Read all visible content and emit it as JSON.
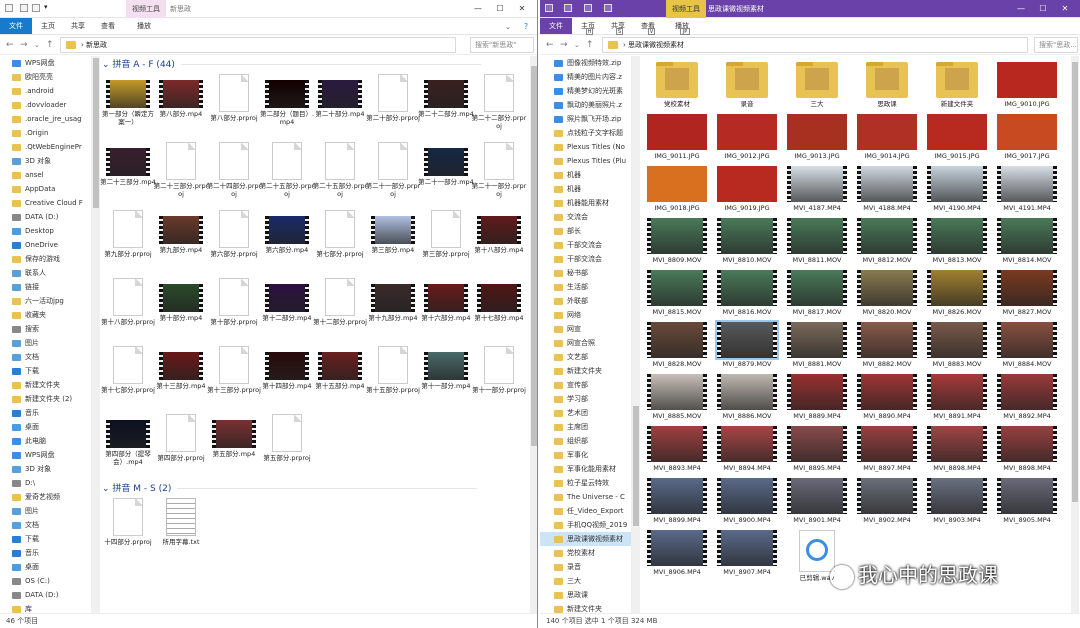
{
  "left": {
    "title": "新思政",
    "context_tab": "视频工具",
    "tabs": [
      "文件",
      "主页",
      "共享",
      "查看",
      "播放"
    ],
    "breadcrumb": "新思政",
    "search": "搜索\"新思政\"",
    "status": "46 个项目",
    "nav": [
      {
        "label": "WPS网盘",
        "icon": "cloud",
        "c": "#3a8ee6"
      },
      {
        "label": "欧阳亮亮",
        "icon": "user",
        "c": "#e8c252"
      },
      {
        "label": ".android",
        "icon": "folder",
        "c": "#e8c252"
      },
      {
        "label": ".dovvloader",
        "icon": "folder",
        "c": "#e8c252"
      },
      {
        "label": ".oracle_jre_usag",
        "icon": "folder",
        "c": "#e8c252"
      },
      {
        "label": ".Origin",
        "icon": "folder",
        "c": "#e8c252"
      },
      {
        "label": ".QtWebEnginePr",
        "icon": "folder",
        "c": "#e8c252"
      },
      {
        "label": "3D 对象",
        "icon": "cube",
        "c": "#5aa0d8"
      },
      {
        "label": "ansel",
        "icon": "folder",
        "c": "#e8c252"
      },
      {
        "label": "AppData",
        "icon": "folder",
        "c": "#e8c252"
      },
      {
        "label": "Creative Cloud F",
        "icon": "folder",
        "c": "#e8c252"
      },
      {
        "label": "DATA (D:)",
        "icon": "drive",
        "c": "#888"
      },
      {
        "label": "Desktop",
        "icon": "folder",
        "c": "#4a9be0"
      },
      {
        "label": "OneDrive",
        "icon": "cloud",
        "c": "#2b7cd3"
      },
      {
        "label": "保存的游戏",
        "icon": "folder",
        "c": "#e8c252"
      },
      {
        "label": "联系人",
        "icon": "folder",
        "c": "#5aa0d8"
      },
      {
        "label": "链接",
        "icon": "link",
        "c": "#5aa0d8"
      },
      {
        "label": "六一活动jpg",
        "icon": "folder",
        "c": "#e8c252"
      },
      {
        "label": "收藏夹",
        "icon": "star",
        "c": "#e8c252"
      },
      {
        "label": "搜索",
        "icon": "search",
        "c": "#888"
      },
      {
        "label": "图片",
        "icon": "folder",
        "c": "#5aa0d8"
      },
      {
        "label": "文档",
        "icon": "folder",
        "c": "#5aa0d8"
      },
      {
        "label": "下载",
        "icon": "down",
        "c": "#2b7cd3"
      },
      {
        "label": "新建文件夹",
        "icon": "folder",
        "c": "#e8c252"
      },
      {
        "label": "新建文件夹 (2)",
        "icon": "folder",
        "c": "#e8c252"
      },
      {
        "label": "音乐",
        "icon": "music",
        "c": "#2b7cd3"
      },
      {
        "label": "桌面",
        "icon": "folder",
        "c": "#4a9be0"
      },
      {
        "label": "此电脑",
        "icon": "pc",
        "c": "#3a8ee6"
      },
      {
        "label": "WPS网盘",
        "icon": "cloud",
        "c": "#3a8ee6"
      },
      {
        "label": "3D 对象",
        "icon": "cube",
        "c": "#5aa0d8"
      },
      {
        "label": "D:\\",
        "icon": "drive",
        "c": "#888"
      },
      {
        "label": "爱奇艺视频",
        "icon": "folder",
        "c": "#e8c252"
      },
      {
        "label": "图片",
        "icon": "folder",
        "c": "#5aa0d8"
      },
      {
        "label": "文档",
        "icon": "folder",
        "c": "#5aa0d8"
      },
      {
        "label": "下载",
        "icon": "down",
        "c": "#2b7cd3"
      },
      {
        "label": "音乐",
        "icon": "music",
        "c": "#2b7cd3"
      },
      {
        "label": "桌面",
        "icon": "folder",
        "c": "#4a9be0"
      },
      {
        "label": "OS (C:)",
        "icon": "drive",
        "c": "#888"
      },
      {
        "label": "DATA (D:)",
        "icon": "drive",
        "c": "#888"
      },
      {
        "label": "库",
        "icon": "lib",
        "c": "#e8c252"
      }
    ],
    "groups": [
      {
        "label": "拼音 A - F (44)",
        "rows": [
          [
            {
              "n": "第一部分（瞬定方案一）",
              "k": "vid",
              "c": "#c49a2a"
            },
            {
              "n": "第八部分.mp4",
              "k": "vid",
              "c": "#7d2a2a"
            },
            {
              "n": "第八部分.prproj",
              "k": "doc"
            },
            {
              "n": "第二部分（题目）.mp4",
              "k": "vid",
              "c": "#120000"
            },
            {
              "n": "第二十部分.mp4",
              "k": "vid",
              "c": "#2a1a40"
            },
            {
              "n": "第二十部分.prproj",
              "k": "doc"
            },
            {
              "n": "第二十二部分.mp4",
              "k": "vid",
              "c": "#3a2020"
            },
            {
              "n": "第二十二部分.prproj",
              "k": "doc"
            }
          ],
          [
            {
              "n": "第二十三部分.mp4",
              "k": "vid",
              "c": "#3a1e30"
            },
            {
              "n": "第二十三部分.prproj",
              "k": "doc"
            },
            {
              "n": "第二十四部分.prproj",
              "k": "doc"
            },
            {
              "n": "第二十五部分.prproj",
              "k": "doc"
            },
            {
              "n": "第二十五部分.prproj",
              "k": "doc"
            },
            {
              "n": "第二十一部分.prproj",
              "k": "doc"
            },
            {
              "n": "第二十一部分.mp4",
              "k": "vid",
              "c": "#152845"
            },
            {
              "n": "第二十一部分.prproj",
              "k": "doc"
            }
          ],
          [
            {
              "n": "第九部分.prproj",
              "k": "doc"
            },
            {
              "n": "第九部分.mp4",
              "k": "vid",
              "c": "#6a3a2a"
            },
            {
              "n": "第六部分.prproj",
              "k": "doc"
            },
            {
              "n": "第六部分.mp4",
              "k": "vid",
              "c": "#1a2a6a"
            },
            {
              "n": "第七部分.prproj",
              "k": "doc"
            },
            {
              "n": "第三部分.mp4",
              "k": "vid",
              "c": "#b0c0e0"
            },
            {
              "n": "第三部分.prproj",
              "k": "doc"
            },
            {
              "n": "第十八部分.mp4",
              "k": "vid",
              "c": "#601a1a"
            }
          ],
          [
            {
              "n": "第十八部分.prproj",
              "k": "doc"
            },
            {
              "n": "第十部分.mp4",
              "k": "vid",
              "c": "#2a4a2a"
            },
            {
              "n": "第十部分.prproj",
              "k": "doc"
            },
            {
              "n": "第十二部分.mp4",
              "k": "vid",
              "c": "#2a1040"
            },
            {
              "n": "第十二部分.prproj",
              "k": "doc"
            },
            {
              "n": "第十九部分.mp4",
              "k": "vid",
              "c": "#3a2a2a"
            },
            {
              "n": "第十六部分.mp4",
              "k": "vid",
              "c": "#6a1a1a"
            },
            {
              "n": "第十七部分.mp4",
              "k": "vid",
              "c": "#501515"
            }
          ],
          [
            {
              "n": "第十七部分.prproj",
              "k": "doc"
            },
            {
              "n": "第十三部分.mp4",
              "k": "vid",
              "c": "#6a1818"
            },
            {
              "n": "第十三部分.prproj",
              "k": "doc"
            },
            {
              "n": "第十四部分.mp4",
              "k": "vid",
              "c": "#2a0a0a"
            },
            {
              "n": "第十五部分.mp4",
              "k": "vid",
              "c": "#6a2020"
            },
            {
              "n": "第十五部分.prproj",
              "k": "doc"
            },
            {
              "n": "第十一部分.mp4",
              "k": "vid",
              "c": "#4a6a6a"
            },
            {
              "n": "第十一部分.prproj",
              "k": "doc"
            }
          ],
          [
            {
              "n": "第四部分（提琴会）.mp4",
              "k": "vid",
              "c": "#0a1020"
            },
            {
              "n": "第四部分.prproj",
              "k": "doc"
            },
            {
              "n": "第五部分.mp4",
              "k": "vid",
              "c": "#7a3030"
            },
            {
              "n": "第五部分.prproj",
              "k": "doc"
            }
          ]
        ]
      },
      {
        "label": "拼音 M - S (2)",
        "rows": [
          [
            {
              "n": "十四部分.prproj",
              "k": "doc"
            },
            {
              "n": "所用字幕.txt",
              "k": "txt"
            }
          ]
        ]
      }
    ]
  },
  "right": {
    "title": "思政课微视频素材",
    "context_tab": "视频工具",
    "tabs": [
      "文件",
      "主页",
      "共享",
      "查看",
      "播放"
    ],
    "key_tips": [
      "H",
      "S",
      "V",
      "JP"
    ],
    "breadcrumb": "思政课微视频素材",
    "search": "搜索\"思政...",
    "status": "140 个项目    选中 1 个项目  324 MB",
    "nav": [
      {
        "label": "图像视频特效.zip",
        "icon": "zip",
        "c": "#3a8ee6"
      },
      {
        "label": "精美的图片内容.z",
        "icon": "zip",
        "c": "#3a8ee6"
      },
      {
        "label": "精美梦幻的光斑素",
        "icon": "zip",
        "c": "#3a8ee6"
      },
      {
        "label": "飘动的美丽照片.z",
        "icon": "zip",
        "c": "#3a8ee6"
      },
      {
        "label": "照片飘飞开场.zip",
        "icon": "zip",
        "c": "#3a8ee6"
      },
      {
        "label": "点钱粒子文字标题",
        "icon": "folder",
        "c": "#e8c252"
      },
      {
        "label": "Plexus Titles (No",
        "icon": "folder",
        "c": "#e8c252"
      },
      {
        "label": "Plexus Titles (Plu",
        "icon": "folder",
        "c": "#e8c252"
      },
      {
        "label": "机器",
        "icon": "folder",
        "c": "#e8c252"
      },
      {
        "label": "机器",
        "icon": "folder",
        "c": "#e8c252"
      },
      {
        "label": "机器能用素材",
        "icon": "folder",
        "c": "#e8c252"
      },
      {
        "label": "交流会",
        "icon": "folder",
        "c": "#e8c252"
      },
      {
        "label": "部长",
        "icon": "folder",
        "c": "#e8c252"
      },
      {
        "label": "干部交流会",
        "icon": "folder",
        "c": "#e8c252"
      },
      {
        "label": "干部交流会",
        "icon": "folder",
        "c": "#e8c252"
      },
      {
        "label": "秘书部",
        "icon": "folder",
        "c": "#e8c252"
      },
      {
        "label": "生活部",
        "icon": "folder",
        "c": "#e8c252"
      },
      {
        "label": "外联部",
        "icon": "folder",
        "c": "#e8c252"
      },
      {
        "label": "网络",
        "icon": "folder",
        "c": "#e8c252"
      },
      {
        "label": "网宣",
        "icon": "folder",
        "c": "#e8c252"
      },
      {
        "label": "网宣合照",
        "icon": "folder",
        "c": "#e8c252"
      },
      {
        "label": "文艺部",
        "icon": "folder",
        "c": "#e8c252"
      },
      {
        "label": "新建文件夹",
        "icon": "folder",
        "c": "#e8c252"
      },
      {
        "label": "宣传部",
        "icon": "folder",
        "c": "#e8c252"
      },
      {
        "label": "学习部",
        "icon": "folder",
        "c": "#e8c252"
      },
      {
        "label": "艺术团",
        "icon": "folder",
        "c": "#e8c252"
      },
      {
        "label": "主席团",
        "icon": "folder",
        "c": "#e8c252"
      },
      {
        "label": "组织部",
        "icon": "folder",
        "c": "#e8c252"
      },
      {
        "label": "军事化",
        "icon": "folder",
        "c": "#e8c252"
      },
      {
        "label": "军事化能用素材",
        "icon": "folder",
        "c": "#e8c252"
      },
      {
        "label": "粒子星云特效",
        "icon": "folder",
        "c": "#e8c252"
      },
      {
        "label": "The Universe - C",
        "icon": "folder",
        "c": "#e8c252"
      },
      {
        "label": "任_Video_Export",
        "icon": "folder",
        "c": "#e8c252"
      },
      {
        "label": "手机QQ视频_2019",
        "icon": "folder",
        "c": "#e8c252"
      },
      {
        "label": "思政课微视频素材",
        "icon": "folder",
        "c": "#e8c252",
        "sel": true
      },
      {
        "label": "党校素材",
        "icon": "folder",
        "c": "#e8c252"
      },
      {
        "label": "录音",
        "icon": "folder",
        "c": "#e8c252"
      },
      {
        "label": "三大",
        "icon": "folder",
        "c": "#e8c252"
      },
      {
        "label": "思政课",
        "icon": "folder",
        "c": "#e8c252"
      },
      {
        "label": "新建文件夹",
        "icon": "folder",
        "c": "#e8c252"
      }
    ],
    "rows": [
      [
        {
          "n": "党校素材",
          "k": "folder"
        },
        {
          "n": "录音",
          "k": "folder"
        },
        {
          "n": "三大",
          "k": "folder"
        },
        {
          "n": "思政课",
          "k": "folder"
        },
        {
          "n": "新建文件夹",
          "k": "folder"
        },
        {
          "n": "IMG_9010.JPG",
          "k": "img",
          "c": "#b8281e"
        }
      ],
      [
        {
          "n": "IMG_9011.JPG",
          "k": "img",
          "c": "#b02520"
        },
        {
          "n": "IMG_9012.JPG",
          "k": "img",
          "c": "#b52a22"
        },
        {
          "n": "IMG_9013.JPG",
          "k": "img",
          "c": "#a83020"
        },
        {
          "n": "IMG_9014.JPG",
          "k": "img",
          "c": "#b03025"
        },
        {
          "n": "IMG_9015.JPG",
          "k": "img",
          "c": "#b82a20"
        },
        {
          "n": "IMG_9017.JPG",
          "k": "img",
          "c": "#c84a20"
        }
      ],
      [
        {
          "n": "IMG_9018.JPG",
          "k": "img",
          "c": "#d87020"
        },
        {
          "n": "IMG_9019.JPG",
          "k": "img",
          "c": "#b82a20"
        },
        {
          "n": "MVI_4187.MP4",
          "k": "vid",
          "c": "#d8e0e8"
        },
        {
          "n": "MVI_4188.MP4",
          "k": "vid",
          "c": "#d0d8e0"
        },
        {
          "n": "MVI_4190.MP4",
          "k": "vid",
          "c": "#c8d4de"
        },
        {
          "n": "MVI_4191.MP4",
          "k": "vid",
          "c": "#d8dee6"
        }
      ],
      [
        {
          "n": "MVI_8809.MOV",
          "k": "vid",
          "c": "#4a7a5a"
        },
        {
          "n": "MVI_8810.MOV",
          "k": "vid",
          "c": "#4a7a5a"
        },
        {
          "n": "MVI_8811.MOV",
          "k": "vid",
          "c": "#4a7a5a"
        },
        {
          "n": "MVI_8812.MOV",
          "k": "vid",
          "c": "#4a7a5a"
        },
        {
          "n": "MVI_8813.MOV",
          "k": "vid",
          "c": "#4a7a5a"
        },
        {
          "n": "MVI_8814.MOV",
          "k": "vid",
          "c": "#4a7a5a"
        }
      ],
      [
        {
          "n": "MVI_8815.MOV",
          "k": "vid",
          "c": "#4a7a5a"
        },
        {
          "n": "MVI_8816.MOV",
          "k": "vid",
          "c": "#4a7a5a"
        },
        {
          "n": "MVI_8817.MOV",
          "k": "vid",
          "c": "#4a7a5a"
        },
        {
          "n": "MVI_8820.MOV",
          "k": "vid",
          "c": "#8a7a50"
        },
        {
          "n": "MVI_8826.MOV",
          "k": "vid",
          "c": "#a08030"
        },
        {
          "n": "MVI_8827.MOV",
          "k": "vid",
          "c": "#7a3a20"
        }
      ],
      [
        {
          "n": "MVI_8828.MOV",
          "k": "vid",
          "c": "#6a4a3a"
        },
        {
          "n": "MVI_8879.MOV",
          "k": "vid",
          "c": "#5a5a5a",
          "sel": true
        },
        {
          "n": "MVI_8881.MOV",
          "k": "vid",
          "c": "#7a6a5a"
        },
        {
          "n": "MVI_8882.MOV",
          "k": "vid",
          "c": "#8a5a4a"
        },
        {
          "n": "MVI_8883.MOV",
          "k": "vid",
          "c": "#7a5a4a"
        },
        {
          "n": "MVI_8884.MOV",
          "k": "vid",
          "c": "#8a5040"
        }
      ],
      [
        {
          "n": "MVI_8885.MOV",
          "k": "vid",
          "c": "#c8c0b8"
        },
        {
          "n": "MVI_8886.MOV",
          "k": "vid",
          "c": "#c0b8b0"
        },
        {
          "n": "MVI_8889.MP4",
          "k": "vid",
          "c": "#9a3030"
        },
        {
          "n": "MVI_8890.MP4",
          "k": "vid",
          "c": "#a03535"
        },
        {
          "n": "MVI_8891.MP4",
          "k": "vid",
          "c": "#a83a3a"
        },
        {
          "n": "MVI_8892.MP4",
          "k": "vid",
          "c": "#9a3a3a"
        }
      ],
      [
        {
          "n": "MVI_8893.MP4",
          "k": "vid",
          "c": "#a04040"
        },
        {
          "n": "MVI_8894.MP4",
          "k": "vid",
          "c": "#a84545"
        },
        {
          "n": "MVI_8895.MP4",
          "k": "vid",
          "c": "#8a4a4a"
        },
        {
          "n": "MVI_8897.MP4",
          "k": "vid",
          "c": "#9a4040"
        },
        {
          "n": "MVI_8898.MP4",
          "k": "vid",
          "c": "#a04545"
        },
        {
          "n": "MVI_8898.MP4",
          "k": "vid",
          "c": "#984040"
        }
      ],
      [
        {
          "n": "MVI_8899.MP4",
          "k": "vid",
          "c": "#5a6a8a"
        },
        {
          "n": "MVI_8900.MP4",
          "k": "vid",
          "c": "#5a6a8a"
        },
        {
          "n": "MVI_8901.MP4",
          "k": "vid",
          "c": "#6a6a7a"
        },
        {
          "n": "MVI_8902.MP4",
          "k": "vid",
          "c": "#6a707a"
        },
        {
          "n": "MVI_8903.MP4",
          "k": "vid",
          "c": "#6a7080"
        },
        {
          "n": "MVI_8905.MP4",
          "k": "vid",
          "c": "#6a6a7a"
        }
      ],
      [
        {
          "n": "MVI_8906.MP4",
          "k": "vid",
          "c": "#5a6a8a"
        },
        {
          "n": "MVI_8907.MP4",
          "k": "vid",
          "c": "#5a6a8a"
        },
        {
          "n": "已剪辑.wav",
          "k": "audio"
        },
        {
          "n": "",
          "k": "none"
        },
        {
          "n": "",
          "k": "none"
        },
        {
          "n": "",
          "k": "none"
        }
      ]
    ]
  },
  "watermark": "我心中的思政课"
}
